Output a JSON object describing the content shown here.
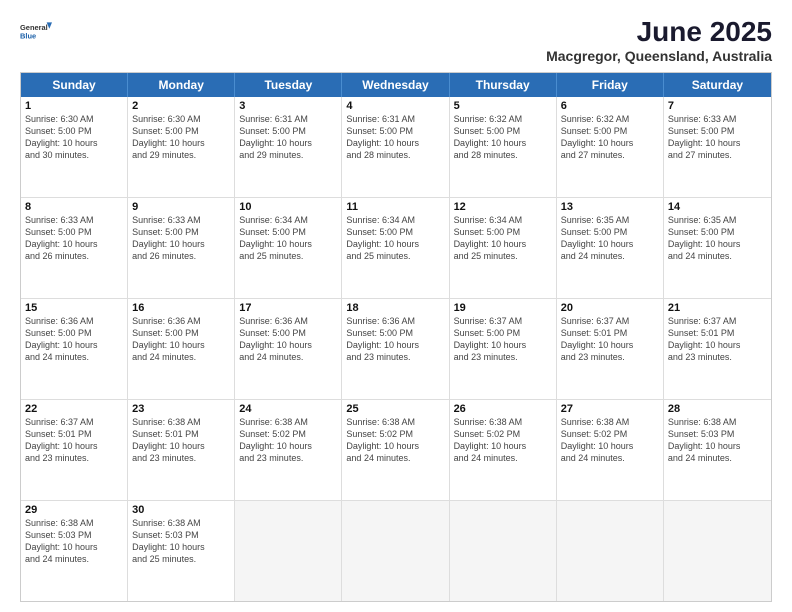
{
  "header": {
    "logo": {
      "general": "General",
      "blue": "Blue"
    },
    "title": "June 2025",
    "location": "Macgregor, Queensland, Australia"
  },
  "calendar": {
    "days": [
      "Sunday",
      "Monday",
      "Tuesday",
      "Wednesday",
      "Thursday",
      "Friday",
      "Saturday"
    ],
    "weeks": [
      [
        null,
        null,
        null,
        null,
        null,
        null,
        null
      ]
    ],
    "cells": [
      {
        "day": null
      },
      {
        "day": null
      },
      {
        "day": null
      },
      {
        "day": null
      },
      {
        "day": null
      },
      {
        "day": null
      },
      {
        "day": null
      }
    ]
  },
  "rows": [
    [
      {
        "n": "",
        "empty": true
      },
      {
        "n": "",
        "empty": true
      },
      {
        "n": "",
        "empty": true
      },
      {
        "n": "",
        "empty": true
      },
      {
        "n": "",
        "empty": true
      },
      {
        "n": "",
        "empty": true
      },
      {
        "n": "",
        "empty": true
      }
    ]
  ],
  "weeks_data": [
    [
      {
        "num": "",
        "empty": true,
        "info": ""
      },
      {
        "num": "",
        "empty": true,
        "info": ""
      },
      {
        "num": "",
        "empty": true,
        "info": ""
      },
      {
        "num": "",
        "empty": true,
        "info": ""
      },
      {
        "num": "",
        "empty": true,
        "info": ""
      },
      {
        "num": "",
        "empty": true,
        "info": ""
      },
      {
        "num": "",
        "empty": true,
        "info": ""
      }
    ],
    [
      {
        "num": "",
        "empty": true,
        "info": ""
      },
      {
        "num": "",
        "empty": true,
        "info": ""
      },
      {
        "num": "",
        "empty": true,
        "info": ""
      },
      {
        "num": "",
        "empty": true,
        "info": ""
      },
      {
        "num": "",
        "empty": true,
        "info": ""
      },
      {
        "num": "",
        "empty": true,
        "info": ""
      },
      {
        "num": "",
        "empty": true,
        "info": ""
      }
    ],
    [
      {
        "num": "",
        "empty": true,
        "info": ""
      },
      {
        "num": "",
        "empty": true,
        "info": ""
      },
      {
        "num": "",
        "empty": true,
        "info": ""
      },
      {
        "num": "",
        "empty": true,
        "info": ""
      },
      {
        "num": "",
        "empty": true,
        "info": ""
      },
      {
        "num": "",
        "empty": true,
        "info": ""
      },
      {
        "num": "",
        "empty": true,
        "info": ""
      }
    ],
    [
      {
        "num": "",
        "empty": true,
        "info": ""
      },
      {
        "num": "",
        "empty": true,
        "info": ""
      },
      {
        "num": "",
        "empty": true,
        "info": ""
      },
      {
        "num": "",
        "empty": true,
        "info": ""
      },
      {
        "num": "",
        "empty": true,
        "info": ""
      },
      {
        "num": "",
        "empty": true,
        "info": ""
      },
      {
        "num": "",
        "empty": true,
        "info": ""
      }
    ],
    [
      {
        "num": "",
        "empty": true,
        "info": ""
      },
      {
        "num": "",
        "empty": true,
        "info": ""
      },
      {
        "num": "",
        "empty": true,
        "info": ""
      },
      {
        "num": "",
        "empty": true,
        "info": ""
      },
      {
        "num": "",
        "empty": true,
        "info": ""
      },
      {
        "num": "",
        "empty": true,
        "info": ""
      },
      {
        "num": "",
        "empty": true,
        "info": ""
      }
    ]
  ]
}
